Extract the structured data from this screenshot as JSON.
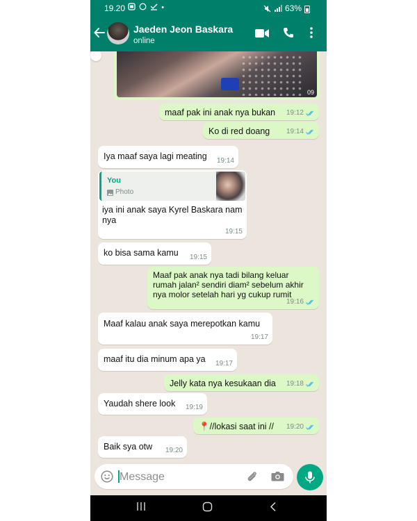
{
  "status_bar": {
    "time": "19.20",
    "battery": "63%"
  },
  "header": {
    "contact_name": "Jaeden Jeon Baskara",
    "status": "online"
  },
  "image_message": {
    "duration": "09"
  },
  "messages": [
    {
      "dir": "out",
      "text": "maaf pak ini anak nya bukan",
      "time": "19:12"
    },
    {
      "dir": "out",
      "text": "Ko di red doang",
      "time": "19:14"
    },
    {
      "dir": "in",
      "text": "Iya maaf saya lagi meating",
      "time": "19:14"
    },
    {
      "dir": "in",
      "reply_to": {
        "author": "You",
        "type": "Photo"
      },
      "text": "iya ini anak saya Kyrel Baskara nam\nnya",
      "time": "19:15"
    },
    {
      "dir": "in",
      "text": "ko bisa sama kamu",
      "time": "19:15"
    },
    {
      "dir": "out",
      "text": "Maaf pak anak nya tadi bilang keluar\nrumah jalan² sendiri diam² sebelum akhir\nnya molor setelah hari yg cukup rumit",
      "time": "19:16"
    },
    {
      "dir": "in",
      "text": "Maaf kalau anak saya merepotkan kamu",
      "time": "19:17"
    },
    {
      "dir": "in",
      "text": "maaf itu dia minum apa ya",
      "time": "19:17"
    },
    {
      "dir": "out",
      "text": "Jelly kata nya kesukaan dia",
      "time": "19:18"
    },
    {
      "dir": "in",
      "text": "Yaudah shere look",
      "time": "19:19"
    },
    {
      "dir": "out",
      "text": "📍//lokasi saat ini //",
      "time": "19:20"
    },
    {
      "dir": "in",
      "text": "Baik sya otw",
      "time": "19:20"
    }
  ],
  "composer": {
    "placeholder": "Message"
  },
  "colors": {
    "header": "#00806b",
    "outgoing_bubble": "#dcf8c6",
    "incoming_bubble": "#ffffff",
    "read_tick": "#53bdeb",
    "accent": "#00a884"
  }
}
